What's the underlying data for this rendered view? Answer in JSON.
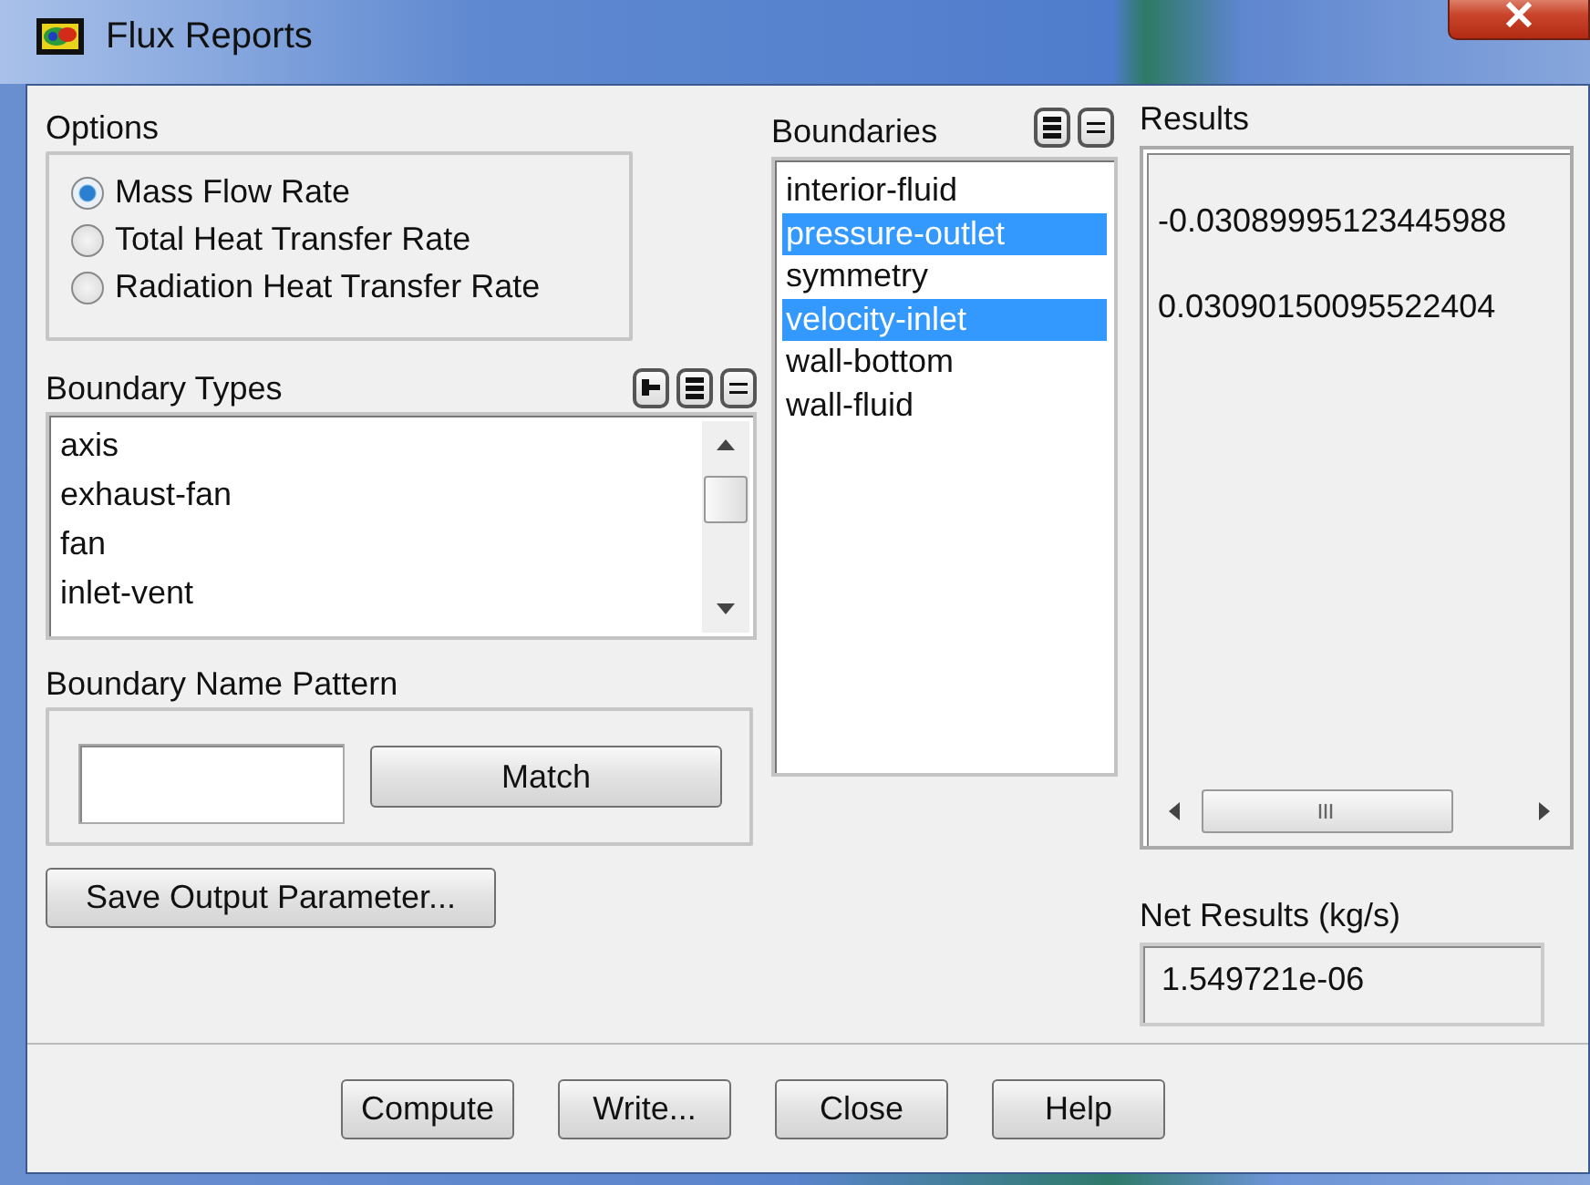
{
  "window": {
    "title": "Flux Reports"
  },
  "options": {
    "label": "Options",
    "items": [
      {
        "label": "Mass Flow Rate",
        "selected": true
      },
      {
        "label": "Total Heat Transfer Rate",
        "selected": false
      },
      {
        "label": "Radiation Heat Transfer Rate",
        "selected": false
      }
    ]
  },
  "boundary_types": {
    "label": "Boundary Types",
    "items": [
      "axis",
      "exhaust-fan",
      "fan",
      "inlet-vent"
    ]
  },
  "boundary_name_pattern": {
    "label": "Boundary Name Pattern",
    "button": "Match"
  },
  "save_button": "Save Output Parameter...",
  "boundaries": {
    "label": "Boundaries",
    "items": [
      {
        "label": "interior-fluid",
        "selected": false
      },
      {
        "label": "pressure-outlet",
        "selected": true
      },
      {
        "label": "symmetry",
        "selected": false
      },
      {
        "label": "velocity-inlet",
        "selected": true
      },
      {
        "label": "wall-bottom",
        "selected": false
      },
      {
        "label": "wall-fluid",
        "selected": false
      }
    ]
  },
  "results": {
    "label": "Results",
    "values": [
      "-0.03089995123445988",
      "0.03090150095522404"
    ]
  },
  "net_results": {
    "label": "Net Results (kg/s)",
    "value": "1.549721e-06"
  },
  "buttons": [
    "Compute",
    "Write...",
    "Close",
    "Help"
  ]
}
